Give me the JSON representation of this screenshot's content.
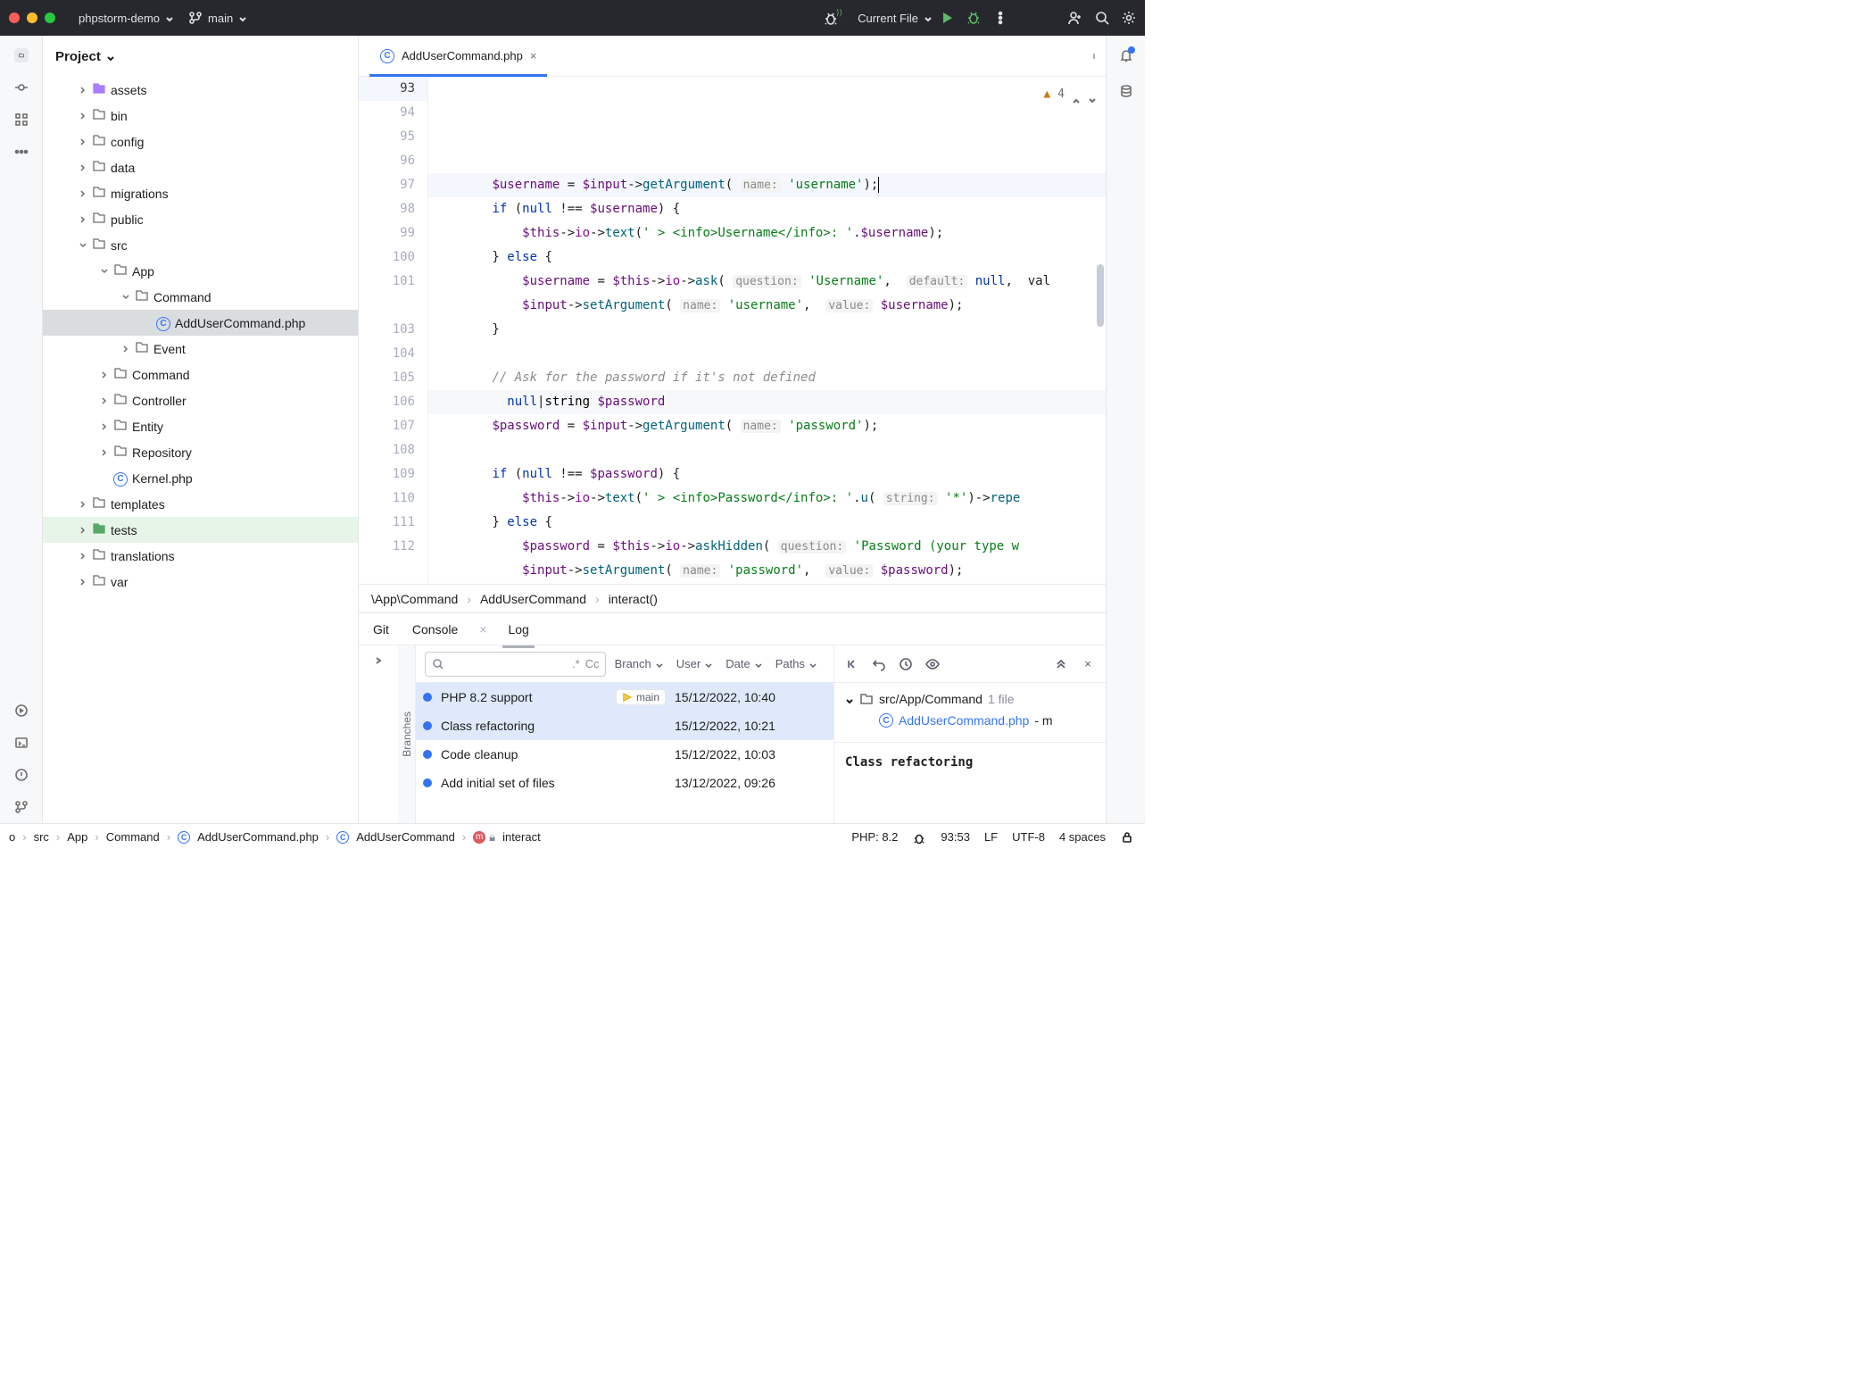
{
  "titlebar": {
    "project_name": "phpstorm-demo",
    "branch": "main",
    "run_config": "Current File"
  },
  "project_header": "Project",
  "project_tree": [
    {
      "label": "assets",
      "depth": 3,
      "folder": "purple",
      "chev": "right"
    },
    {
      "label": "bin",
      "depth": 3,
      "folder": "gray",
      "chev": "right"
    },
    {
      "label": "config",
      "depth": 3,
      "folder": "gray",
      "chev": "right"
    },
    {
      "label": "data",
      "depth": 3,
      "folder": "gray",
      "chev": "right"
    },
    {
      "label": "migrations",
      "depth": 3,
      "folder": "gray",
      "chev": "right"
    },
    {
      "label": "public",
      "depth": 3,
      "folder": "gray",
      "chev": "right"
    },
    {
      "label": "src",
      "depth": 3,
      "folder": "gray",
      "chev": "down"
    },
    {
      "label": "App",
      "depth": 4,
      "folder": "gray",
      "chev": "down"
    },
    {
      "label": "Command",
      "depth": 5,
      "folder": "gray",
      "chev": "down"
    },
    {
      "label": "AddUserCommand.php",
      "depth": 6,
      "file": "php",
      "selected": true
    },
    {
      "label": "Event",
      "depth": 5,
      "folder": "gray",
      "chev": "right"
    },
    {
      "label": "Command",
      "depth": 4,
      "folder": "gray",
      "chev": "right"
    },
    {
      "label": "Controller",
      "depth": 4,
      "folder": "gray",
      "chev": "right"
    },
    {
      "label": "Entity",
      "depth": 4,
      "folder": "gray",
      "chev": "right"
    },
    {
      "label": "Repository",
      "depth": 4,
      "folder": "gray",
      "chev": "right"
    },
    {
      "label": "Kernel.php",
      "depth": 4,
      "file": "php"
    },
    {
      "label": "templates",
      "depth": 3,
      "folder": "gray",
      "chev": "right"
    },
    {
      "label": "tests",
      "depth": 3,
      "folder": "green",
      "chev": "right",
      "rowgreen": true
    },
    {
      "label": "translations",
      "depth": 3,
      "folder": "gray",
      "chev": "right"
    },
    {
      "label": "var",
      "depth": 3,
      "folder": "gray",
      "chev": "right"
    }
  ],
  "tab": {
    "filename": "AddUserCommand.php"
  },
  "inspection": {
    "count": "4"
  },
  "line_numbers": [
    "93",
    "94",
    "95",
    "96",
    "97",
    "98",
    "99",
    "100",
    "101",
    "",
    "103",
    "104",
    "105",
    "106",
    "107",
    "108",
    "109",
    "110",
    "111",
    "112"
  ],
  "editor_breadcrumb": [
    "\\App\\Command",
    "AddUserCommand",
    "interact()"
  ],
  "git_tabs": [
    "Git",
    "Console",
    "Log"
  ],
  "git_toolbar": {
    "regex": ".*",
    "cc": "Cc",
    "filters": [
      "Branch",
      "User",
      "Date",
      "Paths"
    ]
  },
  "commits": [
    {
      "msg": "PHP 8.2 support",
      "date": "15/12/2022, 10:40",
      "branch": "main",
      "sel": true
    },
    {
      "msg": "Class refactoring",
      "date": "15/12/2022, 10:21",
      "sel": true
    },
    {
      "msg": "Code cleanup",
      "date": "15/12/2022, 10:03"
    },
    {
      "msg": "Add initial set of files",
      "date": "13/12/2022, 09:26"
    }
  ],
  "detail": {
    "folder": "src/App/Command",
    "file_count": "1 file",
    "file": "AddUserCommand.php",
    "suffix": "- m",
    "title": "Class refactoring"
  },
  "statusbar": {
    "crumbs": [
      "o",
      "src",
      "App",
      "Command",
      "AddUserCommand.php",
      "AddUserCommand",
      "interact"
    ],
    "php": "PHP: 8.2",
    "pos": "93:53",
    "lf": "LF",
    "enc": "UTF-8",
    "indent": "4 spaces"
  }
}
